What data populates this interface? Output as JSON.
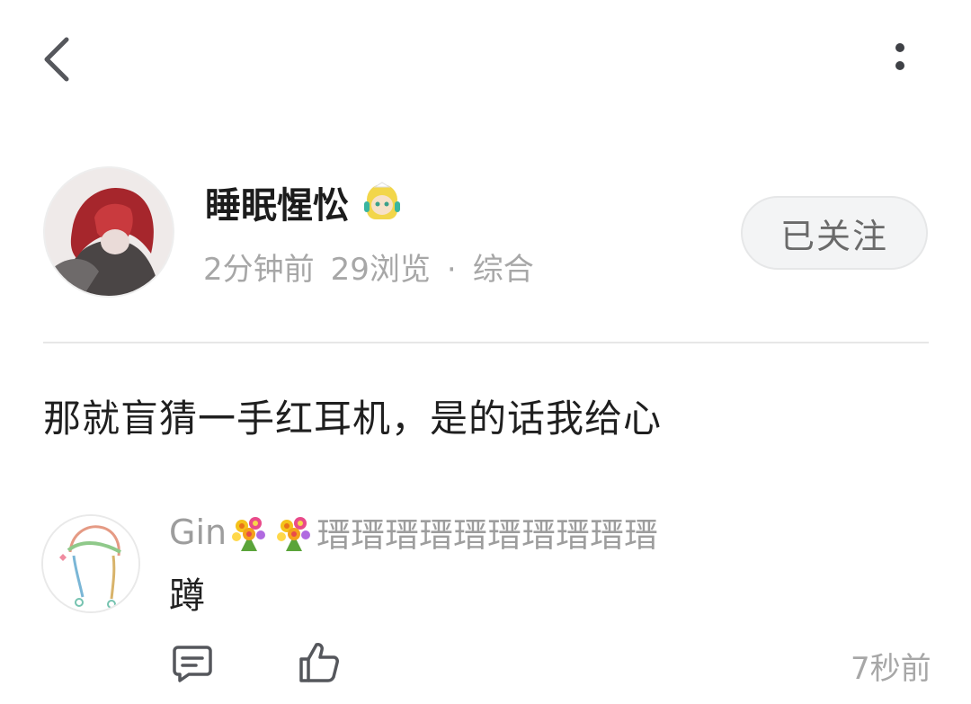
{
  "header": {
    "back_icon": "chevron-left-icon",
    "more_icon": "more-vertical-icon"
  },
  "author": {
    "name": "睡眠惺忪",
    "badge_icon": "chibi-avatar-badge-icon",
    "time": "2分钟前",
    "views": "29浏览",
    "separator": "·",
    "category": "综合",
    "follow_label": "已关注"
  },
  "post": {
    "content": "那就盲猜一手红耳机，是的话我给心"
  },
  "comment": {
    "name_prefix": "Gin",
    "name_suffix": "瑨瑨瑨瑨瑨瑨瑨瑨瑨瑨",
    "flower_icon": "bouquet-icon",
    "text": "蹲",
    "time": "7秒前",
    "reply_icon": "comment-icon",
    "like_icon": "thumbs-up-icon"
  },
  "colors": {
    "primary_text": "#1f1f1f",
    "secondary_text": "#a7a7a7",
    "divider": "#e7e7e7",
    "follow_bg": "#f3f4f5"
  }
}
